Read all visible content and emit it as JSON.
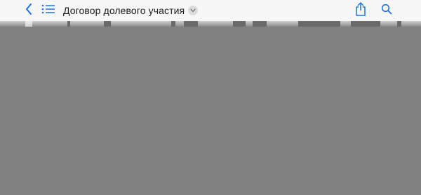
{
  "toolbar": {
    "title": "Договор долевого участия",
    "accent_color": "#1a73e8",
    "icons": [
      "back-chevron-icon",
      "list-icon",
      "chevron-down-icon",
      "share-icon",
      "search-icon"
    ]
  }
}
